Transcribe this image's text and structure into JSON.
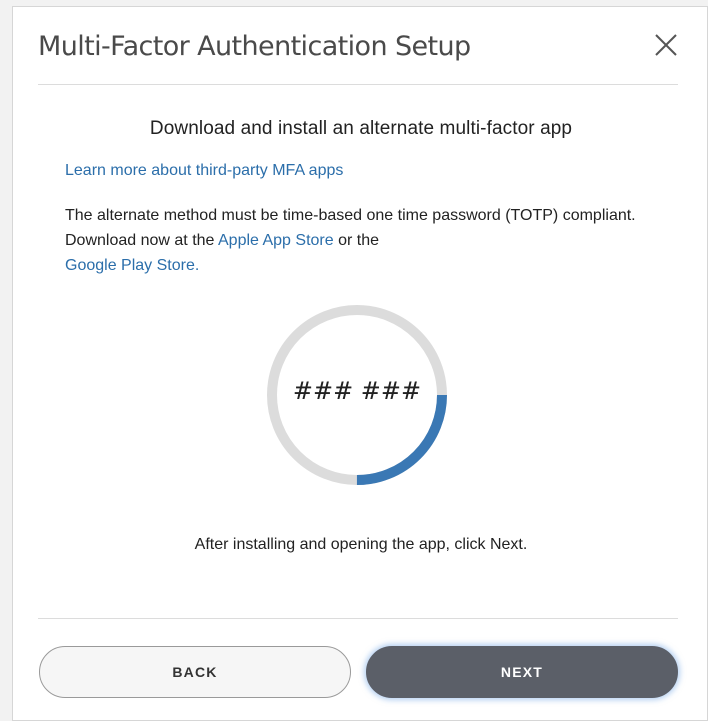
{
  "dialog": {
    "title": "Multi-Factor Authentication Setup",
    "close_icon": "close-icon"
  },
  "content": {
    "subtitle": "Download and install an alternate multi-factor app",
    "learn_more_link": "Learn more about third-party MFA apps",
    "description_part1": "The alternate method must be time-based one time password (TOTP) compliant. Download now at the ",
    "apple_store_link": "Apple App Store",
    "description_part2": " or the ",
    "google_play_link": "Google Play Store.",
    "instruction": "After installing and opening the app, click Next."
  },
  "timer": {
    "code_text": "### ###",
    "progress_fraction": 0.25,
    "track_color": "#dcdcdc",
    "progress_color": "#3a78b4"
  },
  "footer": {
    "back_label": "BACK",
    "next_label": "NEXT"
  },
  "colors": {
    "link": "#2b6eaa",
    "primary_button": "#5b5f68",
    "focus_glow": "#78aae6"
  }
}
